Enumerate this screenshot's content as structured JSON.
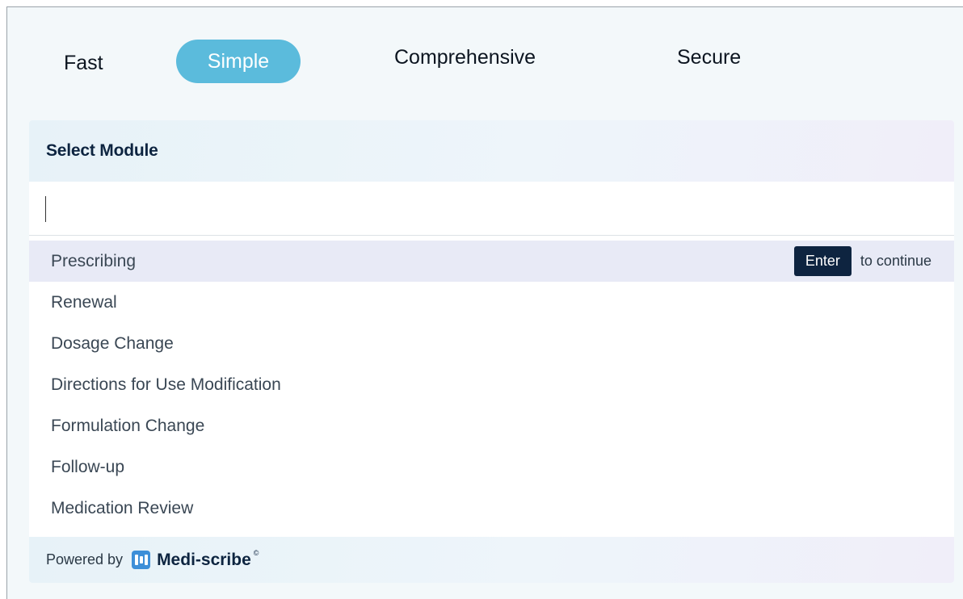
{
  "colors": {
    "accent": "#5bbbdc",
    "navy": "#0e2440"
  },
  "tabs": [
    {
      "label": "Fast",
      "selected": false
    },
    {
      "label": "Simple",
      "selected": true
    },
    {
      "label": "Comprehensive",
      "selected": false
    },
    {
      "label": "Secure",
      "selected": false
    }
  ],
  "panel": {
    "title": "Select Module",
    "search": {
      "value": "",
      "placeholder": ""
    },
    "items": [
      {
        "label": "Prescribing",
        "highlighted": true
      },
      {
        "label": "Renewal"
      },
      {
        "label": "Dosage Change"
      },
      {
        "label": "Directions for Use Modification"
      },
      {
        "label": "Formulation Change"
      },
      {
        "label": "Follow-up"
      },
      {
        "label": "Medication Review"
      }
    ],
    "hint": {
      "key": "Enter",
      "text": "to continue"
    }
  },
  "footer": {
    "powered_by": "Powered by",
    "brand_icon": "medi-scribe-logo-icon",
    "brand_name": "Medi-scribe",
    "brand_mark": "©"
  }
}
